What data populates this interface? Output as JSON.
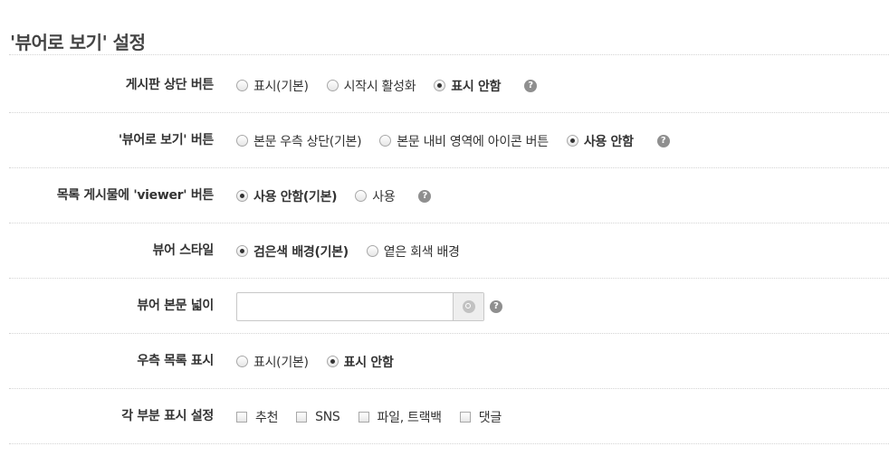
{
  "section": {
    "title": "'뷰어로 보기' 설정"
  },
  "help_glyph": "?",
  "rows": [
    {
      "label": "게시판 상단 버튼",
      "options": [
        {
          "text": "표시(기본)",
          "selected": false
        },
        {
          "text": "시작시 활성화",
          "selected": false
        },
        {
          "text": "표시 안함",
          "selected": true
        }
      ]
    },
    {
      "label": "'뷰어로 보기' 버튼",
      "options": [
        {
          "text": "본문 우측 상단(기본)",
          "selected": false
        },
        {
          "text": "본문 내비 영역에 아이콘 버튼",
          "selected": false
        },
        {
          "text": "사용 안함",
          "selected": true
        }
      ]
    },
    {
      "label": "목록 게시물에 'viewer' 버튼",
      "options": [
        {
          "text": "사용 안함(기본)",
          "selected": true
        },
        {
          "text": "사용",
          "selected": false
        }
      ]
    },
    {
      "label": "뷰어 스타일",
      "options": [
        {
          "text": "검은색 배경(기본)",
          "selected": true
        },
        {
          "text": "옅은 회색 배경",
          "selected": false
        }
      ]
    },
    {
      "label": "뷰어 본문 넓이",
      "input": {
        "value": "",
        "placeholder": ""
      }
    },
    {
      "label": "우측 목록 표시",
      "options": [
        {
          "text": "표시(기본)",
          "selected": false
        },
        {
          "text": "표시 안함",
          "selected": true
        }
      ]
    },
    {
      "label": "각 부분 표시 설정",
      "checkboxes": [
        {
          "text": "추천",
          "checked": false
        },
        {
          "text": "SNS",
          "checked": false
        },
        {
          "text": "파일, 트랙백",
          "checked": false
        },
        {
          "text": "댓글",
          "checked": false
        }
      ]
    }
  ],
  "colors": {
    "text": "#333333",
    "help_icon": "#8f8f8f",
    "divider": "#d4d4d4"
  }
}
